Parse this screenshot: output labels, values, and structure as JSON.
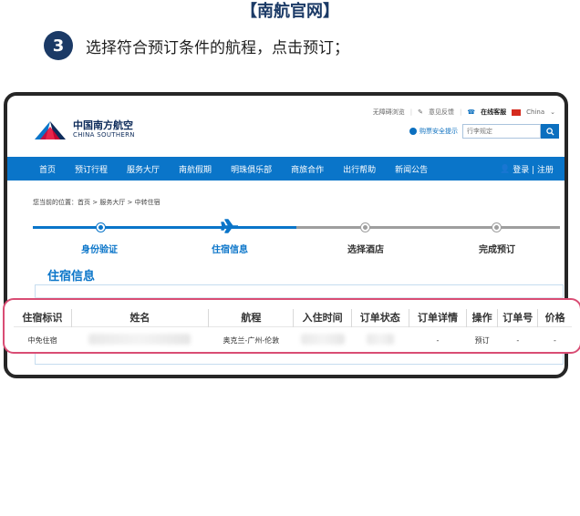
{
  "heading": "【南航官网】",
  "step": {
    "number": "3",
    "text": "选择符合预订条件的航程，点击预订；"
  },
  "header": {
    "util_links": [
      "无障碍浏览",
      "意见反馈",
      "在线客服",
      "China"
    ],
    "logo_cn": "中国南方航空",
    "logo_en": "CHINA SOUTHERN",
    "safety_tip": "购票安全提示",
    "search_placeholder": "行李规定"
  },
  "nav": {
    "items": [
      "首页",
      "预订行程",
      "服务大厅",
      "南航假期",
      "明珠俱乐部",
      "商旅合作",
      "出行帮助",
      "新闻公告"
    ],
    "login": "登录 | 注册"
  },
  "breadcrumb": "您当前的位置：首页 > 服务大厅 > 中转住宿",
  "progress": {
    "steps": [
      "身份验证",
      "住宿信息",
      "选择酒店",
      "完成预订"
    ],
    "current_index": 1
  },
  "section_title": "住宿信息",
  "table": {
    "headers": [
      "住宿标识",
      "姓名",
      "航程",
      "入住时间",
      "订单状态",
      "订单详情",
      "操作",
      "订单号",
      "价格"
    ],
    "row": {
      "type": "中免住宿",
      "route": "奥克兰-广州-伦敦",
      "detail": "-",
      "action": "预订",
      "order_no": "-",
      "price": "-"
    }
  },
  "colors": {
    "brand_blue": "#0a75c9",
    "heading_navy": "#1b3a66",
    "highlight_pink": "#d94d74",
    "inactive_gray": "#9e9e9e"
  }
}
